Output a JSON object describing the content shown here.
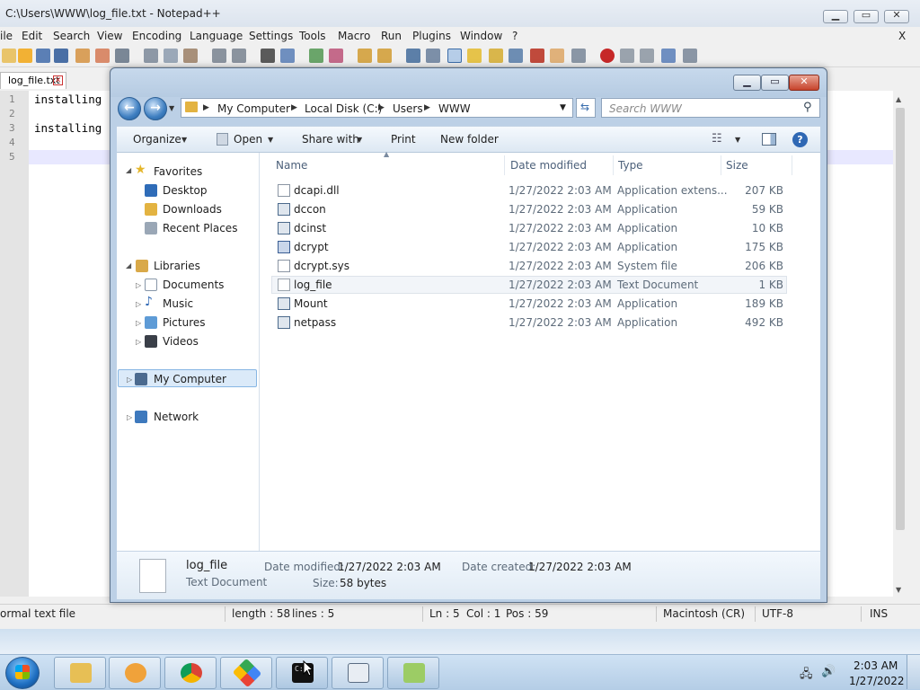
{
  "notepad": {
    "title": "C:\\Users\\WWW\\log_file.txt - Notepad++",
    "menu": [
      "ile",
      "Edit",
      "Search",
      "View",
      "Encoding",
      "Language",
      "Settings",
      "Tools",
      "Macro",
      "Run",
      "Plugins",
      "Window",
      "?"
    ],
    "menu_close": "X",
    "tab_label": "log_file.txt",
    "line_numbers": [
      "1",
      "2",
      "3",
      "4",
      "5"
    ],
    "lines": [
      "installing",
      "",
      "installing",
      "",
      ""
    ],
    "status": {
      "type": "ormal text file",
      "length": "length : 58",
      "lines": "lines : 5",
      "ln": "Ln : 5",
      "col": "Col : 1",
      "pos": "Pos : 59",
      "eol": "Macintosh (CR)",
      "encoding": "UTF-8",
      "mode": "INS"
    }
  },
  "explorer": {
    "breadcrumbs": [
      "My Computer",
      "Local Disk (C:)",
      "Users",
      "WWW"
    ],
    "search_placeholder": "Search WWW",
    "commands": {
      "organize": "Organize",
      "open": "Open",
      "share": "Share with",
      "print": "Print",
      "new_folder": "New folder"
    },
    "nav": {
      "favorites": "Favorites",
      "desktop": "Desktop",
      "downloads": "Downloads",
      "recent": "Recent Places",
      "libraries": "Libraries",
      "documents": "Documents",
      "music": "Music",
      "pictures": "Pictures",
      "videos": "Videos",
      "computer": "My Computer",
      "network": "Network"
    },
    "columns": {
      "name": "Name",
      "date": "Date modified",
      "type": "Type",
      "size": "Size"
    },
    "files": [
      {
        "name": "dcapi.dll",
        "date": "1/27/2022 2:03 AM",
        "type": "Application extens...",
        "size": "207 KB"
      },
      {
        "name": "dccon",
        "date": "1/27/2022 2:03 AM",
        "type": "Application",
        "size": "59 KB"
      },
      {
        "name": "dcinst",
        "date": "1/27/2022 2:03 AM",
        "type": "Application",
        "size": "10 KB"
      },
      {
        "name": "dcrypt",
        "date": "1/27/2022 2:03 AM",
        "type": "Application",
        "size": "175 KB"
      },
      {
        "name": "dcrypt.sys",
        "date": "1/27/2022 2:03 AM",
        "type": "System file",
        "size": "206 KB"
      },
      {
        "name": "log_file",
        "date": "1/27/2022 2:03 AM",
        "type": "Text Document",
        "size": "1 KB"
      },
      {
        "name": "Mount",
        "date": "1/27/2022 2:03 AM",
        "type": "Application",
        "size": "189 KB"
      },
      {
        "name": "netpass",
        "date": "1/27/2022 2:03 AM",
        "type": "Application",
        "size": "492 KB"
      }
    ],
    "details": {
      "name": "log_file",
      "type": "Text Document",
      "modified_label": "Date modified:",
      "modified": "1/27/2022 2:03 AM",
      "created_label": "Date created:",
      "created": "1/27/2022 2:03 AM",
      "size_label": "Size:",
      "size": "58 bytes"
    }
  },
  "taskbar": {
    "time": "2:03 AM",
    "date": "1/27/2022",
    "cmd_label": "C:\\"
  },
  "colors": {
    "explorer_frame": "#bcd0e6",
    "selection": "#dbeaf9",
    "taskbar": "#b4cde6",
    "close_red": "#c7432b"
  }
}
